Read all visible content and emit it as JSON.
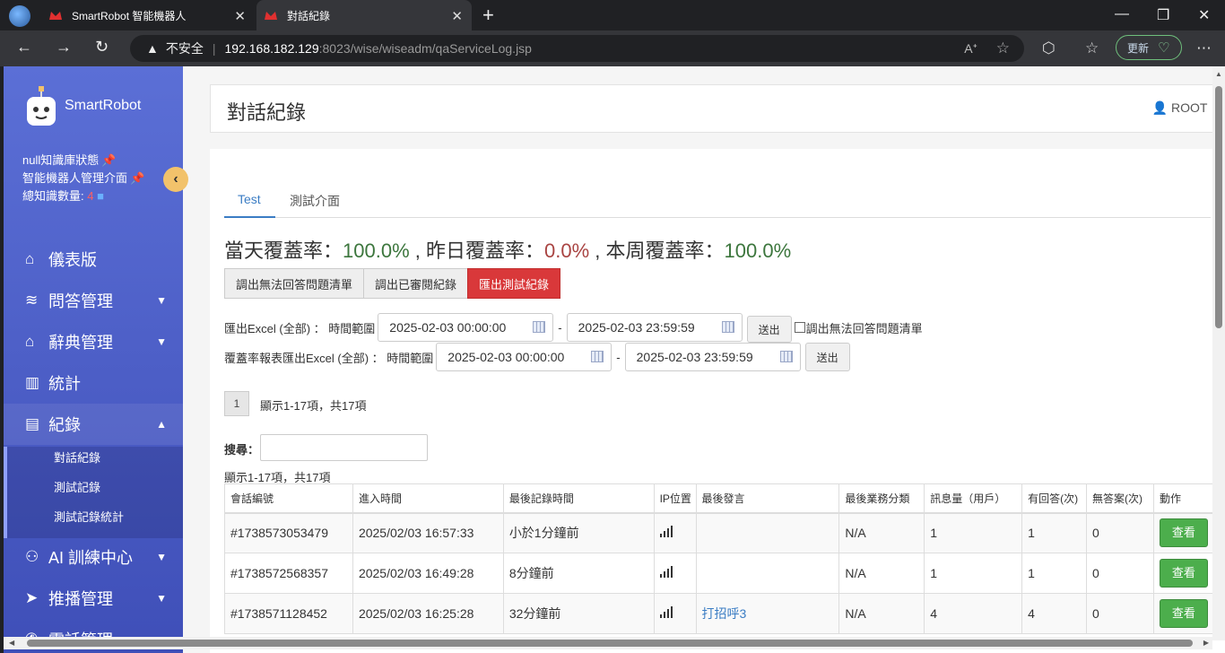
{
  "browser": {
    "tabs": [
      {
        "title": "SmartRobot 智能機器人"
      },
      {
        "title": "對話紀錄"
      }
    ],
    "address": {
      "security_label": "不安全",
      "host": "192.168.182.129",
      "path": ":8023/wise/wiseadm/qaServiceLog.jsp"
    },
    "update_label": "更新"
  },
  "sidebar": {
    "brand": "SmartRobot",
    "status_line1": "null知識庫狀態",
    "status_line2": "智能機器人管理介面",
    "knowledge_label": "總知識數量:",
    "knowledge_count": "4",
    "menu": [
      {
        "label": "儀表版",
        "icon": "home-icon"
      },
      {
        "label": "問答管理",
        "icon": "database-icon"
      },
      {
        "label": "辭典管理",
        "icon": "graduation-cap-icon"
      },
      {
        "label": "統計",
        "icon": "bar-chart-icon"
      },
      {
        "label": "紀錄",
        "icon": "clipboard-icon"
      },
      {
        "label": "AI 訓練中心",
        "icon": "ai-icon"
      },
      {
        "label": "推播管理",
        "icon": "send-icon"
      },
      {
        "label": "電話管理",
        "icon": "phone-icon"
      }
    ],
    "submenu": [
      "對話紀錄",
      "測試記錄",
      "測試記錄統計"
    ]
  },
  "header": {
    "title": "對話紀錄",
    "user": "ROOT"
  },
  "tabs": [
    "Test",
    "測試介面"
  ],
  "coverage": {
    "today_label": "當天覆蓋率：",
    "today_value": "100.0%",
    "sep1": " , ",
    "yesterday_label": "昨日覆蓋率：",
    "yesterday_value": "0.0%",
    "sep2": " , ",
    "week_label": "本周覆蓋率：",
    "week_value": "100.0%"
  },
  "buttons": {
    "unanswered": "調出無法回答問題清單",
    "reviewed": "調出已審閱紀錄",
    "export_test": "匯出測試紀錄"
  },
  "export_row": {
    "label": "匯出Excel (全部) ： 時間範圍",
    "start": "2025-02-03 00:00:00",
    "end": "2025-02-03 23:59:59",
    "submit": "送出",
    "checkbox_label": "調出無法回答問題清單"
  },
  "coverage_row": {
    "label": "覆蓋率報表匯出Excel (全部) ： 時間範圍",
    "start": "2025-02-03 00:00:00",
    "end": "2025-02-03 23:59:59",
    "submit": "送出"
  },
  "pagination": {
    "page": "1",
    "info": "顯示1-17項，共17項"
  },
  "search_label": "搜尋：",
  "show_info": "顯示1-17項，共17項",
  "table": {
    "columns": [
      "會話編號",
      "進入時間",
      "最後記錄時間",
      "IP位置",
      "最後發言",
      "最後業務分類",
      "訊息量（用戶）",
      "有回答(次)",
      "無答案(次)",
      "動作"
    ],
    "rows": [
      {
        "id": "#1738573053479",
        "enter": "2025/02/03 16:57:33",
        "last": "小於1分鐘前",
        "last_msg": "",
        "category": "N/A",
        "msgs": "1",
        "answered": "1",
        "unanswered": "0",
        "action": "查看"
      },
      {
        "id": "#1738572568357",
        "enter": "2025/02/03 16:49:28",
        "last": "8分鐘前",
        "last_msg": "",
        "category": "N/A",
        "msgs": "1",
        "answered": "1",
        "unanswered": "0",
        "action": "查看"
      },
      {
        "id": "#1738571128452",
        "enter": "2025/02/03 16:25:28",
        "last": "32分鐘前",
        "last_msg": "打招呼3",
        "category": "N/A",
        "msgs": "4",
        "answered": "4",
        "unanswered": "0",
        "action": "查看"
      }
    ]
  }
}
